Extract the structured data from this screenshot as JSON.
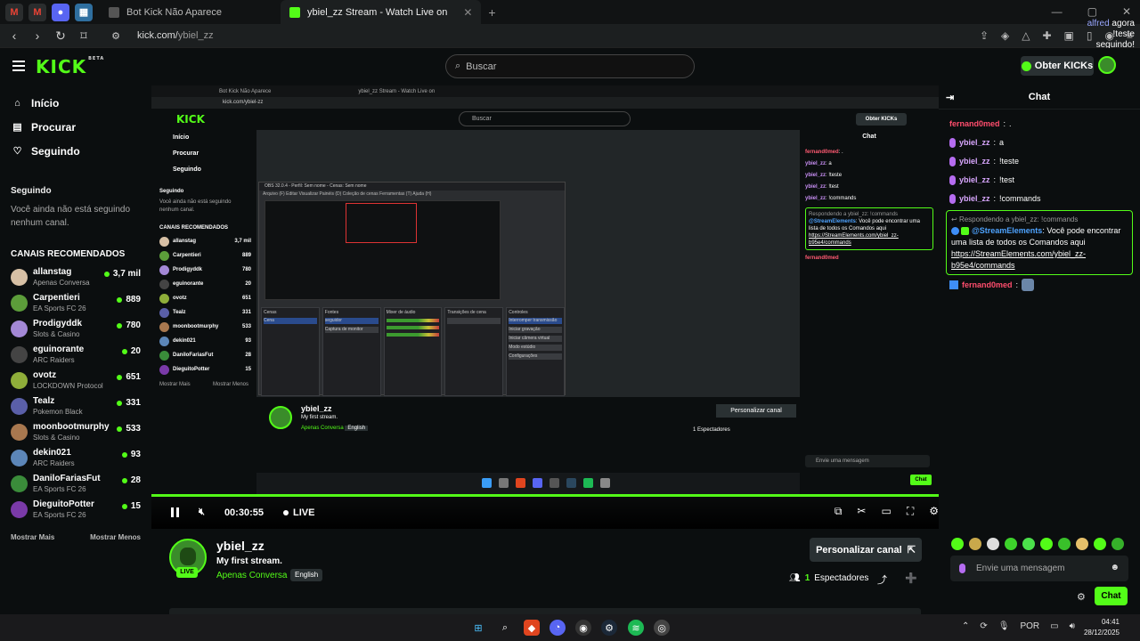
{
  "browser": {
    "tabs": [
      {
        "label": "Bot Kick Não Aparece",
        "active": false
      },
      {
        "label": "ybiel_zz Stream - Watch Live on",
        "active": true
      }
    ],
    "url_host": "kick.com/",
    "url_path": "ybiel_zz"
  },
  "notification": {
    "user": "alfred",
    "when": "agora",
    "text": "!teste",
    "text2": "seguindo!"
  },
  "header": {
    "logo": "KICK",
    "logo_badge": "BETA",
    "search_placeholder": "Buscar",
    "obter_label": "Obter KICKs"
  },
  "sidebar": {
    "nav": [
      {
        "label": "Início",
        "icon": "home-icon"
      },
      {
        "label": "Procurar",
        "icon": "browse-icon"
      },
      {
        "label": "Seguindo",
        "icon": "heart-icon"
      }
    ],
    "following_title": "Seguindo",
    "following_empty": "Você ainda não está seguindo nenhum canal.",
    "recommended_title": "CANAIS RECOMENDADOS",
    "channels": [
      {
        "name": "allanstag",
        "category": "Apenas Conversa",
        "viewers": "3,7 mil",
        "color": "#d7c0a5"
      },
      {
        "name": "Carpentieri",
        "category": "EA Sports FC 26",
        "viewers": "889",
        "color": "#5c9d3a"
      },
      {
        "name": "Prodigyddk",
        "category": "Slots & Casino",
        "viewers": "780",
        "color": "#a388d6"
      },
      {
        "name": "eguinorante",
        "category": "ARC Raiders",
        "viewers": "20",
        "color": "#444444"
      },
      {
        "name": "ovotz",
        "category": "LOCKDOWN Protocol",
        "viewers": "651",
        "color": "#8fae3a"
      },
      {
        "name": "Tealz",
        "category": "Pokemon Black",
        "viewers": "331",
        "color": "#5a5fa8"
      },
      {
        "name": "moonbootmurphy",
        "category": "Slots & Casino",
        "viewers": "533",
        "color": "#a8784f"
      },
      {
        "name": "dekin021",
        "category": "ARC Raiders",
        "viewers": "93",
        "color": "#5c86b8"
      },
      {
        "name": "DaniloFariasFut",
        "category": "EA Sports FC 26",
        "viewers": "28",
        "color": "#3a8c3a"
      },
      {
        "name": "DieguitoPotter",
        "category": "EA Sports FC 26",
        "viewers": "15",
        "color": "#7a3aa8"
      }
    ],
    "show_more": "Mostrar Mais",
    "show_less": "Mostrar Menos"
  },
  "player": {
    "time": "00:30:55",
    "live": "LIVE",
    "progress": 1.0
  },
  "stream": {
    "name": "ybiel_zz",
    "title": "My first stream.",
    "category": "Apenas Conversa",
    "language": "English",
    "live_badge": "LIVE",
    "customize_label": "Personalizar canal",
    "viewers_count": "1",
    "viewers_label": "Espectadores"
  },
  "chat": {
    "title": "Chat",
    "messages": [
      {
        "user": "fernand0med",
        "text": ".",
        "color": "red",
        "badge": false
      },
      {
        "user": "ybiel_zz",
        "text": "a",
        "color": "purple",
        "badge": true
      },
      {
        "user": "ybiel_zz",
        "text": "!teste",
        "color": "purple",
        "badge": true
      },
      {
        "user": "ybiel_zz",
        "text": "!test",
        "color": "purple",
        "badge": true
      },
      {
        "user": "ybiel_zz",
        "text": "!commands",
        "color": "purple",
        "badge": true
      }
    ],
    "reply": {
      "replying_to": "Respondendo a ybiel_zz: !commands",
      "user": "@StreamElements",
      "text": "Você pode encontrar uma lista de todos os Comandos aqui",
      "link": "https://StreamElements.com/ybiel_zz-b95e4/commands"
    },
    "last": {
      "user": "fernand0med"
    },
    "input_placeholder": "Envie uma mensagem",
    "send_label": "Chat"
  },
  "nested": {
    "tab1": "Bot Kick Não Aparece",
    "tab2": "ybiel_zz Stream - Watch Live on",
    "url": "kick.com/ybiel-zz",
    "search": "Buscar",
    "obter": "Obter KICKs",
    "nav": [
      "Início",
      "Procurar",
      "Seguindo"
    ],
    "following_title": "Seguindo",
    "following_empty": "Você ainda não está seguindo nenhum canal.",
    "recommended_title": "CANAIS RECOMENDADOS",
    "channels": [
      {
        "name": "allanstag",
        "viewers": "3,7 mil"
      },
      {
        "name": "Carpentieri",
        "viewers": "889"
      },
      {
        "name": "Prodigyddk",
        "viewers": "780"
      },
      {
        "name": "eguinorante",
        "viewers": "20"
      },
      {
        "name": "ovotz",
        "viewers": "651"
      },
      {
        "name": "Tealz",
        "viewers": "331"
      },
      {
        "name": "moonbootmurphy",
        "viewers": "533"
      },
      {
        "name": "dekin021",
        "viewers": "93"
      },
      {
        "name": "DaniloFariasFut",
        "viewers": "28"
      },
      {
        "name": "DieguitoPotter",
        "viewers": "15"
      }
    ],
    "show_more": "Mostrar Mais",
    "show_less": "Mostrar Menos",
    "chat_title": "Chat",
    "chat": [
      {
        "user": "fernand0med",
        "text": ".",
        "red": true
      },
      {
        "user": "ybiel_zz",
        "text": "a",
        "red": false
      },
      {
        "user": "ybiel_zz",
        "text": "!teste",
        "red": false
      },
      {
        "user": "ybiel_zz",
        "text": "!test",
        "red": false
      },
      {
        "user": "ybiel_zz",
        "text": "!commands",
        "red": false
      }
    ],
    "reply_to": "Respondendo a ybiel_zz: !commands",
    "reply_user": "@StreamElements",
    "reply_text": "Você pode encontrar uma lista de todos os Comandos aqui",
    "reply_link": "https://StreamElements.com/ybiel_zz-b95e4/commands",
    "last_user": "fernand0med",
    "stream_name": "ybiel_zz",
    "stream_title": "My first stream.",
    "stream_cat": "Apenas Conversa",
    "stream_lang": "English",
    "customize": "Personalizar canal",
    "viewers": "1 Espectadores",
    "obs_title": "OBS 32.0.4 - Perfil: Sem nome - Cenas: Sem nome",
    "obs_menu": "Arquivo (F)   Editar   Visualizar   Painéis (D)   Coleção de cenas   Ferramentas (T)   Ajuda (H)",
    "obs_docks": [
      "Cenas",
      "Fontes",
      "Mixer de áudio",
      "Transições de cena",
      "Controles"
    ],
    "obs_scene": "Cena",
    "obs_sources": [
      "seguidor",
      "Captura de monitor"
    ],
    "obs_controls": [
      "Interromper transmissão",
      "Iniciar gravação",
      "Iniciar câmera virtual",
      "Modo estúdio",
      "Configurações"
    ],
    "chat_input": "Envie uma mensagem",
    "chat_send": "Chat"
  },
  "taskbar": {
    "lang": "POR",
    "time": "04:41",
    "date": "28/12/2025"
  },
  "colors": {
    "accent": "#53fc18",
    "background": "#0b0e0f",
    "panel": "#2a3133"
  }
}
